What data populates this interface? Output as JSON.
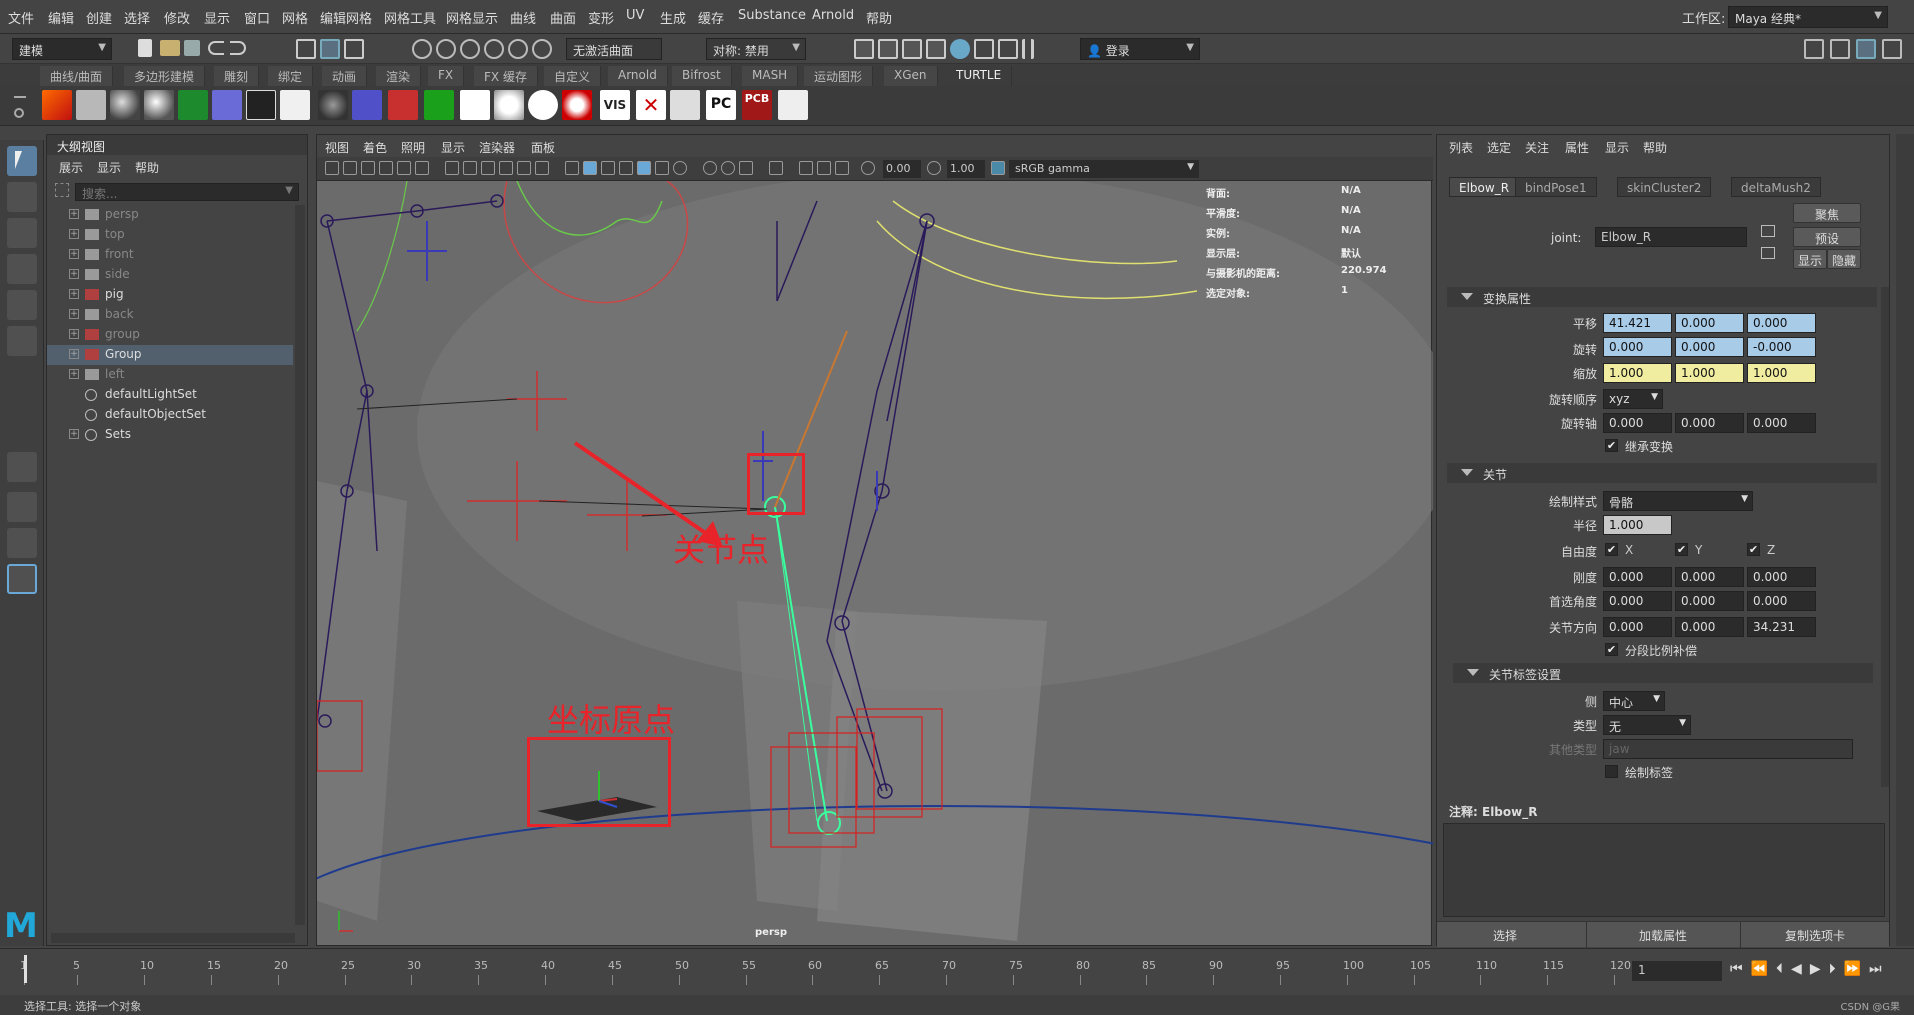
{
  "menubar": {
    "items": [
      "文件",
      "编辑",
      "创建",
      "选择",
      "修改",
      "显示",
      "窗口",
      "网格",
      "编辑网格",
      "网格工具",
      "网格显示",
      "曲线",
      "曲面",
      "变形",
      "UV",
      "生成",
      "缓存",
      "Substance",
      "Arnold",
      "帮助"
    ],
    "workspace_label": "工作区:",
    "workspace_value": "Maya 经典*"
  },
  "toolbar": {
    "mode": "建模",
    "live_surface": "无激活曲面",
    "symmetry": "对称: 禁用",
    "login": "登录"
  },
  "shelf_tabs": [
    "曲线/曲面",
    "多边形建模",
    "雕刻",
    "绑定",
    "动画",
    "渲染",
    "FX",
    "FX 缓存",
    "自定义",
    "Arnold",
    "Bifrost",
    "MASH",
    "运动图形",
    "XGen",
    "TURTLE"
  ],
  "shelf_active": "TURTLE",
  "shelf_icon_text": [
    "VIS",
    "PC",
    "PCB"
  ],
  "outliner": {
    "title": "大纲视图",
    "menu": [
      "展示",
      "显示",
      "帮助"
    ],
    "search_placeholder": "搜索...",
    "items": [
      {
        "label": "persp",
        "dim": true
      },
      {
        "label": "top",
        "dim": true
      },
      {
        "label": "front",
        "dim": true
      },
      {
        "label": "side",
        "dim": true
      },
      {
        "label": "pig",
        "dim": false
      },
      {
        "label": "back",
        "dim": true
      },
      {
        "label": "group",
        "dim": true
      },
      {
        "label": "Group",
        "dim": false,
        "selected": true
      },
      {
        "label": "left",
        "dim": true
      },
      {
        "label": "defaultLightSet",
        "dim": false
      },
      {
        "label": "defaultObjectSet",
        "dim": false
      },
      {
        "label": "Sets",
        "dim": false
      }
    ]
  },
  "viewport": {
    "menu": [
      "视图",
      "着色",
      "照明",
      "显示",
      "渲染器",
      "面板"
    ],
    "exposure": "0.00",
    "gamma": "1.00",
    "colorspace": "sRGB gamma",
    "camera_label": "persp",
    "hud": [
      {
        "k": "背面:",
        "v": "N/A"
      },
      {
        "k": "平滑度:",
        "v": "N/A"
      },
      {
        "k": "实例:",
        "v": "N/A"
      },
      {
        "k": "显示层:",
        "v": "默认"
      },
      {
        "k": "与摄影机的距离:",
        "v": "220.974"
      },
      {
        "k": "选定对象:",
        "v": "1"
      }
    ],
    "annotations": {
      "joint": "关节点",
      "origin": "坐标原点"
    }
  },
  "attr_editor": {
    "menu": [
      "列表",
      "选定",
      "关注",
      "属性",
      "显示",
      "帮助"
    ],
    "tabs": [
      "Elbow_R",
      "bindPose1",
      "skinCluster2",
      "deltaMush2"
    ],
    "joint_label": "joint:",
    "joint_name": "Elbow_R",
    "btn_focus": "聚焦",
    "btn_preset": "预设",
    "btn_show": "显示",
    "btn_hide": "隐藏",
    "section_transform": "变换属性",
    "translate_label": "平移",
    "translate": [
      "41.421",
      "0.000",
      "0.000"
    ],
    "rotate_label": "旋转",
    "rotate": [
      "0.000",
      "0.000",
      "-0.000"
    ],
    "scale_label": "缩放",
    "scale": [
      "1.000",
      "1.000",
      "1.000"
    ],
    "rotate_order_label": "旋转顺序",
    "rotate_order": "xyz",
    "rotate_axis_label": "旋转轴",
    "rotate_axis": [
      "0.000",
      "0.000",
      "0.000"
    ],
    "inherit_label": "继承变换",
    "section_joint": "关节",
    "draw_style_label": "绘制样式",
    "draw_style": "骨骼",
    "radius_label": "半径",
    "radius": "1.000",
    "dof_label": "自由度",
    "dof": [
      "X",
      "Y",
      "Z"
    ],
    "stiffness_label": "刚度",
    "stiffness": [
      "0.000",
      "0.000",
      "0.000"
    ],
    "pref_angle_label": "首选角度",
    "pref_angle": [
      "0.000",
      "0.000",
      "0.000"
    ],
    "joint_orient_label": "关节方向",
    "joint_orient": [
      "0.000",
      "0.000",
      "34.231"
    ],
    "segment_scale_label": "分段比例补偿",
    "section_label": "关节标签设置",
    "side_label": "侧",
    "side": "中心",
    "type_label": "类型",
    "type": "无",
    "other_type_label": "其他类型",
    "other_type": "jaw",
    "draw_label_label": "绘制标签",
    "notes_label": "注释:",
    "notes_name": "Elbow_R",
    "bottom": [
      "选择",
      "加载属性",
      "复制选项卡"
    ]
  },
  "timeline": {
    "ticks": [
      "1",
      "5",
      "10",
      "15",
      "20",
      "25",
      "30",
      "35",
      "40",
      "45",
      "50",
      "55",
      "60",
      "65",
      "70",
      "75",
      "80",
      "85",
      "90",
      "95",
      "100",
      "105",
      "110",
      "115",
      "120"
    ],
    "current_frame": "1"
  },
  "status": {
    "text": "选择工具: 选择一个对象",
    "watermark": "CSDN @G果"
  },
  "colors": {
    "annotation_red": "#e8232a",
    "joint_selected": "#39ff9e",
    "translate_field": "#a8cbe8",
    "scale_field": "#f0eca0"
  }
}
